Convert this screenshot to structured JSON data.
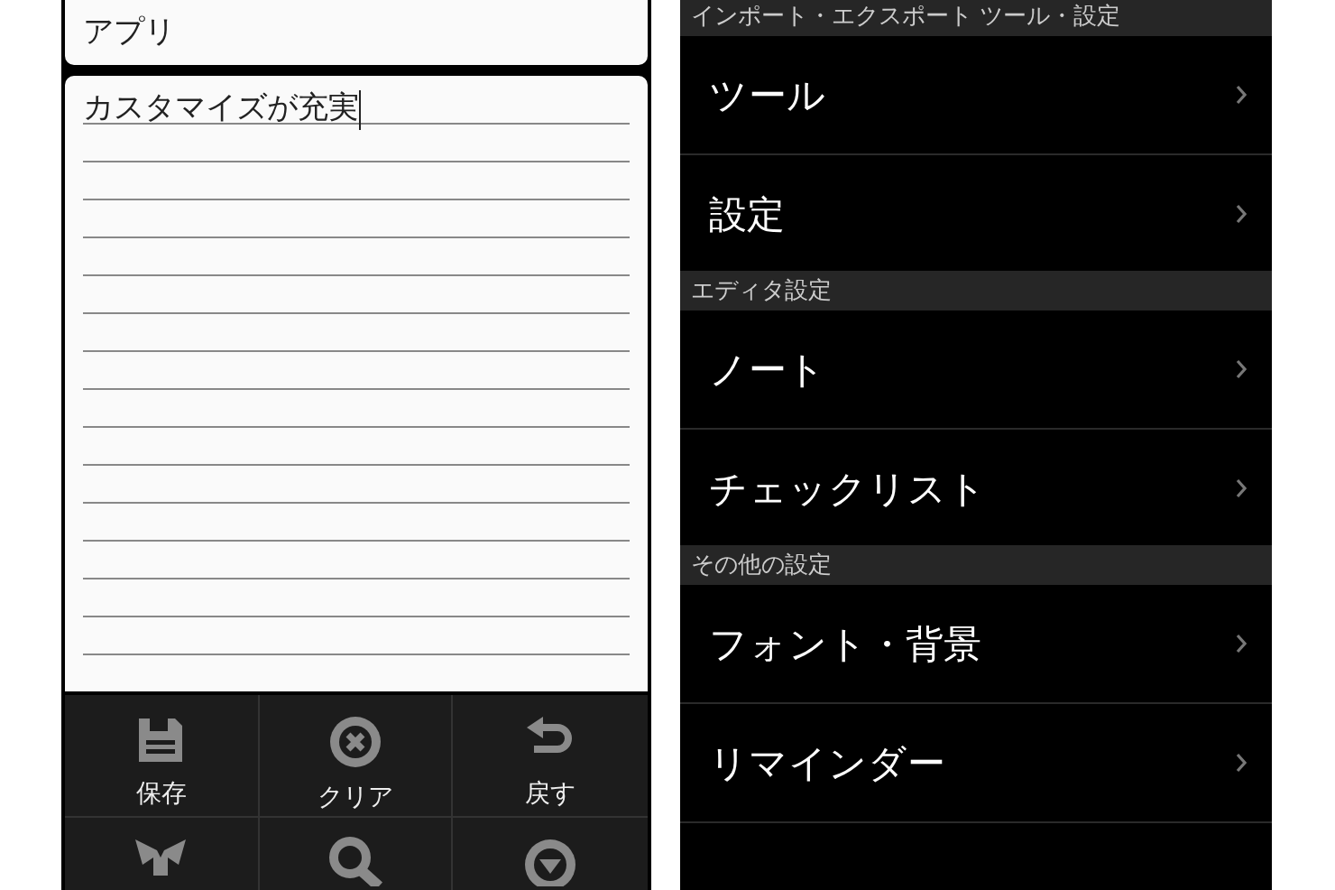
{
  "editor": {
    "title_field": {
      "value": "アプリ"
    },
    "note_field": {
      "value": "カスタマイズが充実"
    },
    "toolbar": [
      {
        "kind": "save",
        "label": "保存"
      },
      {
        "kind": "clear",
        "label": "クリア"
      },
      {
        "kind": "undo",
        "label": "戻す"
      },
      {
        "kind": "share"
      },
      {
        "kind": "search"
      },
      {
        "kind": "more"
      }
    ]
  },
  "settings": {
    "sections": [
      {
        "header": "インポート・エクスポート ツール・設定",
        "items": [
          "ツール",
          "設定"
        ]
      },
      {
        "header": "エディタ設定",
        "items": [
          "ノート",
          "チェックリスト"
        ]
      },
      {
        "header": "その他の設定",
        "items": [
          "フォント・背景",
          "リマインダー"
        ]
      }
    ]
  }
}
